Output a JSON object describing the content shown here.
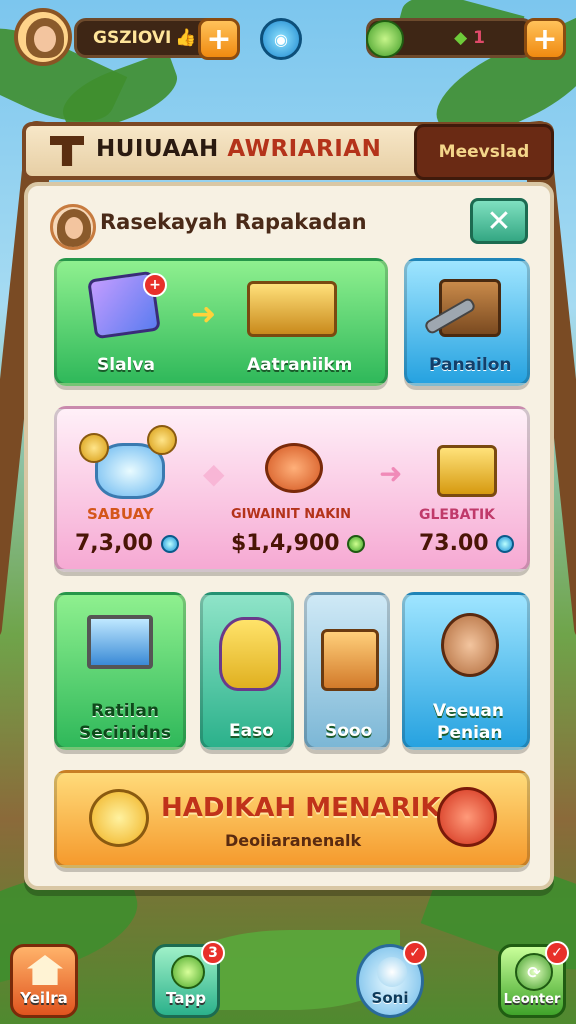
{
  "top_bar": {
    "player_name": "GSZIOVI",
    "coins_value": "1",
    "add_label": "+"
  },
  "header": {
    "title_part1": "HUIUAAH",
    "title_part2": "AWRIARIAN",
    "button_label": "Meevslad"
  },
  "panel": {
    "title": "Rasekayah Rapakadan",
    "close_label": "✕",
    "row1": {
      "card1_left": "Slalva",
      "card1_right": "Aatraniikm",
      "card2": "Panailon"
    },
    "offer": {
      "items": [
        {
          "name": "SABUAY",
          "price": "7,3,00"
        },
        {
          "name": "GIWAINIT NAKIN",
          "price": "$1,4,900"
        },
        {
          "name": "GLEBATIK",
          "price": "73.00"
        }
      ]
    },
    "row3": [
      {
        "label_line1": "Ratilan",
        "label_line2": "Secinidns"
      },
      {
        "label_line1": "Easo",
        "label_line2": ""
      },
      {
        "label_line1": "Sooo",
        "label_line2": ""
      },
      {
        "label_line1": "Veeuan",
        "label_line2": "Penian"
      }
    ],
    "banner": {
      "title": "HADIKAH MENARIK",
      "subtitle": "Deoiiaranenalk"
    }
  },
  "bottom_nav": [
    {
      "label": "Yeilra",
      "badge": ""
    },
    {
      "label": "Tapp",
      "badge": "3"
    },
    {
      "label": "Soni",
      "badge": ""
    },
    {
      "label": "Leonter",
      "badge": ""
    }
  ],
  "colors": {
    "accent_orange": "#f08a10",
    "panel_bg": "#f7f1e3",
    "header_border": "#7b4824"
  }
}
